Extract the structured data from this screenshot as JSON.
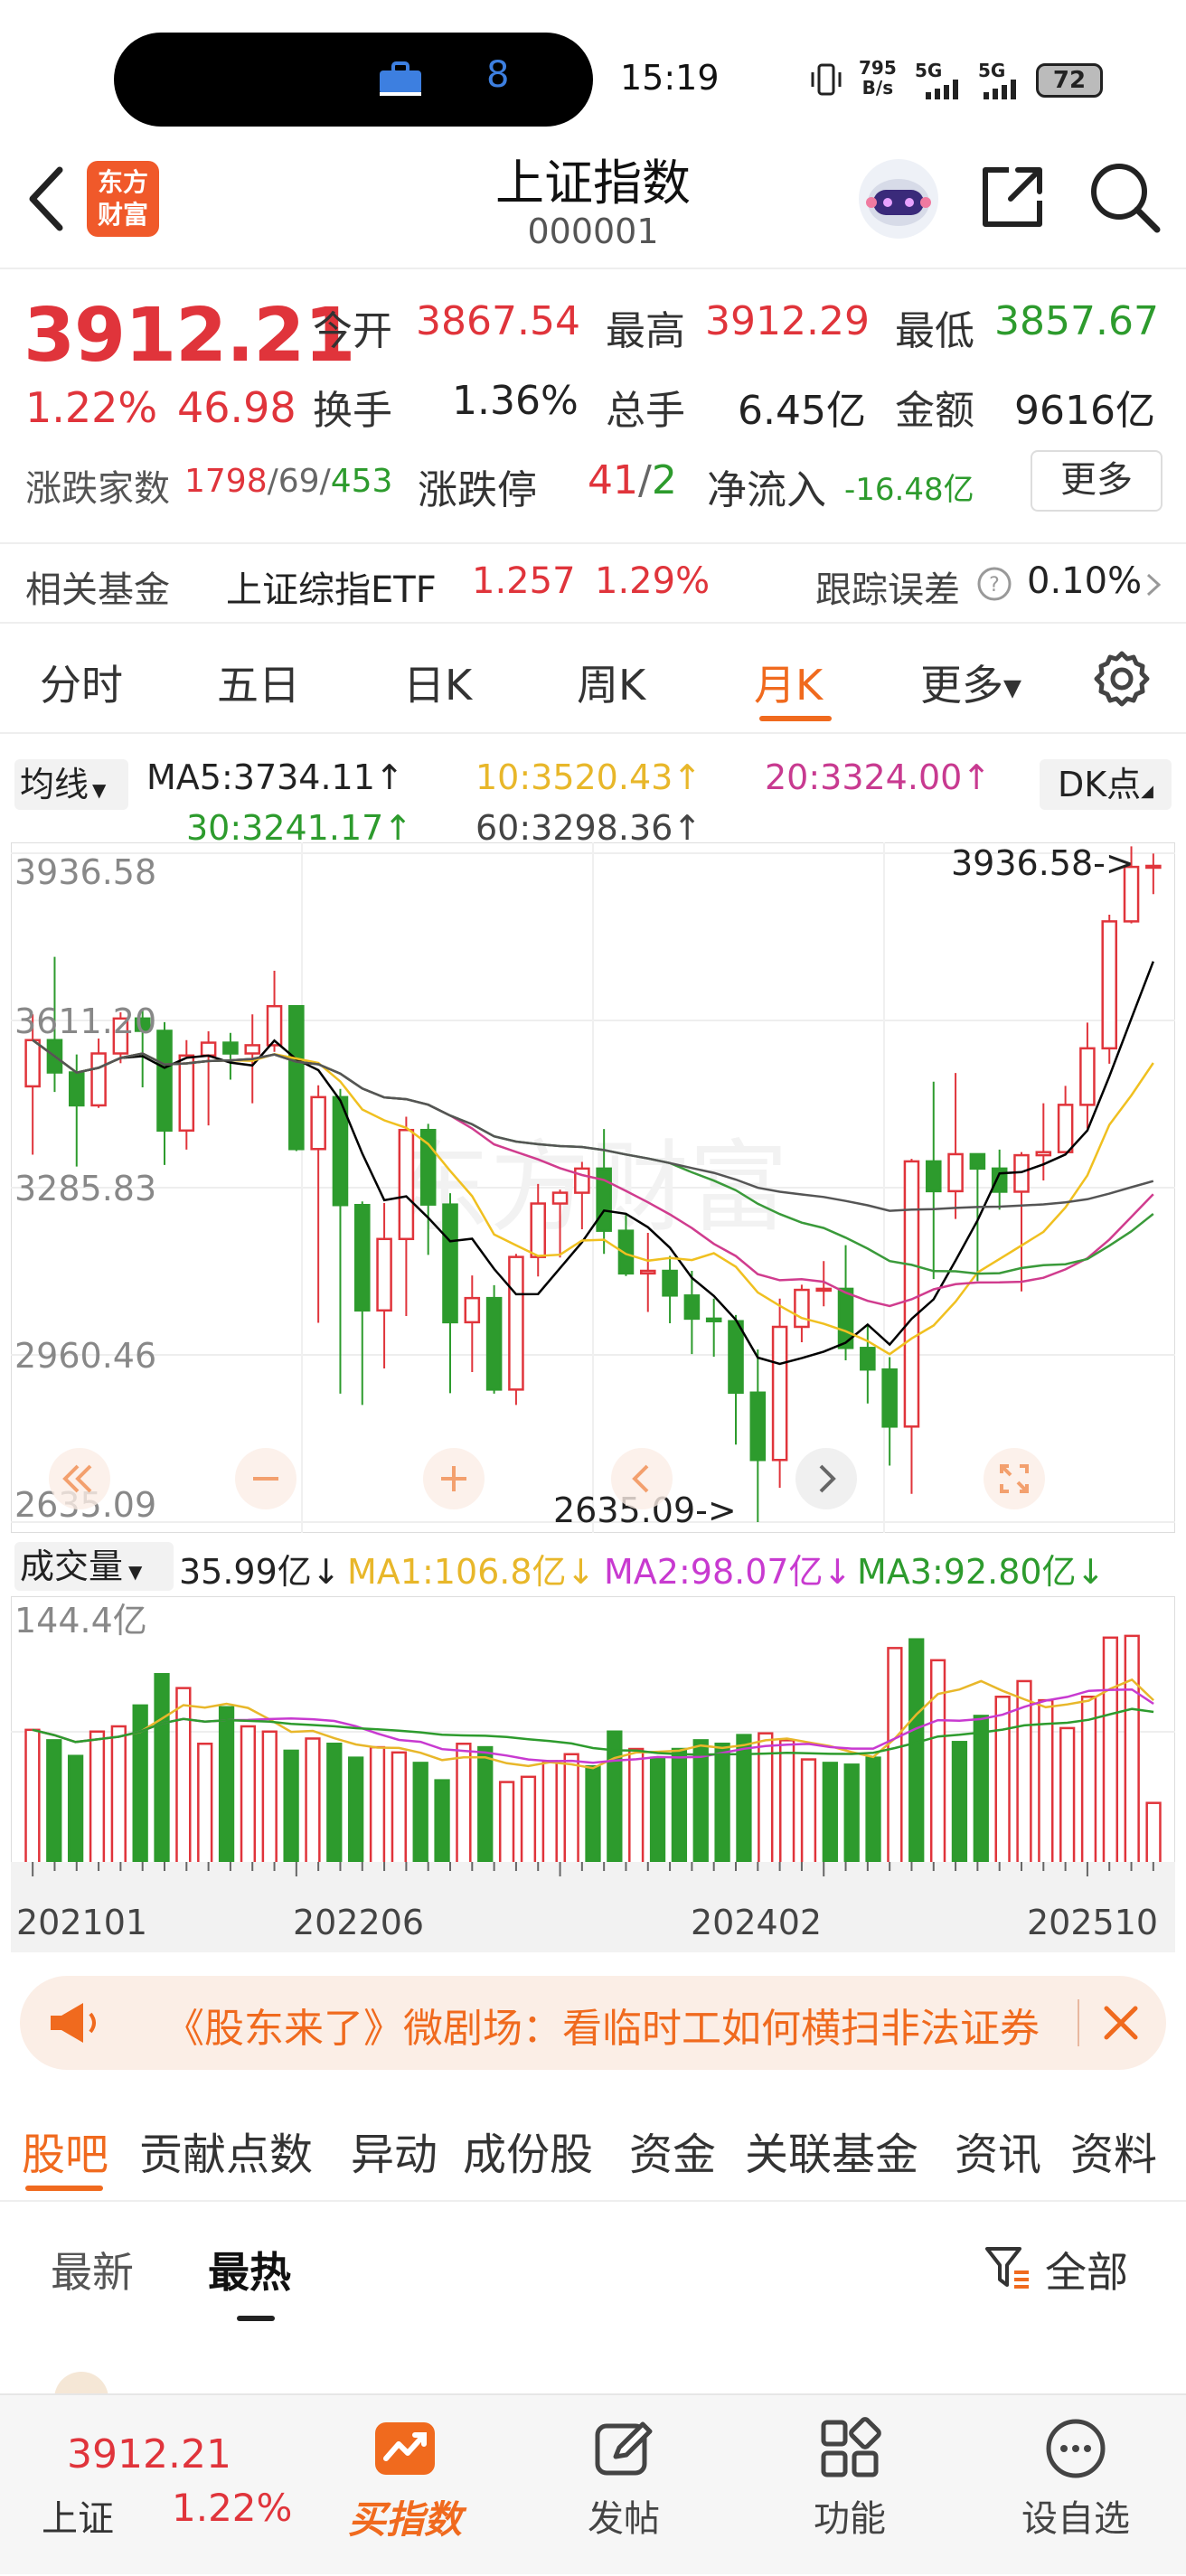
{
  "status": {
    "notif_count": "8",
    "time": "15:19",
    "net_speed_top": "795",
    "net_speed_bottom": "B/s",
    "sig1": "5G",
    "sig2": "5G",
    "battery": "72"
  },
  "header": {
    "logo_top": "东方",
    "logo_bottom": "财富",
    "title": "上证指数",
    "code": "000001"
  },
  "quote": {
    "price": "3912.21",
    "change_pct": "1.22%",
    "change": "46.98",
    "open_label": "今开",
    "open": "3867.54",
    "high_label": "最高",
    "high": "3912.29",
    "low_label": "最低",
    "low": "3857.67",
    "turnover_label": "换手",
    "turnover": "1.36%",
    "volume_label": "总手",
    "volume": "6.45亿",
    "amount_label": "金额",
    "amount": "9616亿",
    "breadth_label": "涨跌家数",
    "up": "1798",
    "flat": "69",
    "down": "453",
    "limit_label": "涨跌停",
    "limit_up": "41",
    "limit_down": "2",
    "inflow_label": "净流入",
    "inflow": "-16.48亿",
    "more": "更多"
  },
  "fund": {
    "label": "相关基金",
    "name": "上证综指ETF",
    "price": "1.257",
    "pct": "1.29%",
    "err_label": "跟踪误差",
    "err": "0.10%"
  },
  "tabs": [
    "分时",
    "五日",
    "日K",
    "周K",
    "月K",
    "更多"
  ],
  "ma": {
    "selector": "均线",
    "ma5": "MA5:3734.11↑",
    "ma10": "10:3520.43↑",
    "ma20": "20:3324.00↑",
    "ma30": "30:3241.17↑",
    "ma60": "60:3298.36↑",
    "dk": "DK点"
  },
  "chart_data": {
    "type": "candlestick",
    "y_ticks": [
      "3936.58",
      "3611.20",
      "3285.83",
      "2960.46",
      "2635.09"
    ],
    "ylim": [
      2635.09,
      3936.58
    ],
    "max_label": "3936.58->",
    "min_label": "2635.09->",
    "x_labels": [
      "202101",
      "202206",
      "202402",
      "202510"
    ],
    "colors": {
      "up": "#e0343b",
      "down": "#2d9b2d",
      "ma5": "#000000",
      "ma10": "#f0c020",
      "ma20": "#d03c8e",
      "ma30": "#3a9a3a",
      "ma60": "#555555"
    },
    "candles": [
      [
        3483,
        3573,
        3350,
        3623
      ],
      [
        3573,
        3510,
        3472,
        3735
      ],
      [
        3510,
        3446,
        3327,
        3545
      ],
      [
        3446,
        3547,
        3441,
        3576
      ],
      [
        3547,
        3615,
        3528,
        3627
      ],
      [
        3615,
        3591,
        3481,
        3631
      ],
      [
        3591,
        3397,
        3330,
        3608
      ],
      [
        3397,
        3543,
        3360,
        3573
      ],
      [
        3543,
        3568,
        3407,
        3590
      ],
      [
        3568,
        3547,
        3496,
        3587
      ],
      [
        3547,
        3563,
        3450,
        3623
      ],
      [
        3563,
        3639,
        3550,
        3708
      ],
      [
        3639,
        3361,
        3357,
        3639
      ],
      [
        3361,
        3462,
        3023,
        3485
      ],
      [
        3462,
        3252,
        2885,
        3478
      ],
      [
        3252,
        3047,
        2863,
        3259
      ],
      [
        3047,
        3186,
        2934,
        3256
      ],
      [
        3186,
        3398,
        3036,
        3424
      ],
      [
        3398,
        3253,
        3155,
        3410
      ],
      [
        3253,
        3024,
        2886,
        3275
      ],
      [
        3024,
        3071,
        2927,
        3115
      ],
      [
        3071,
        2893,
        2885,
        3096
      ],
      [
        2893,
        3151,
        2863,
        3157
      ],
      [
        3151,
        3255,
        3113,
        3293
      ],
      [
        3255,
        3276,
        3150,
        3282
      ],
      [
        3276,
        3323,
        3205,
        3336
      ],
      [
        3323,
        3202,
        3157,
        3400
      ],
      [
        3202,
        3119,
        3114,
        3235
      ],
      [
        3119,
        3124,
        3044,
        3198
      ],
      [
        3124,
        3076,
        3022,
        3153
      ],
      [
        3076,
        3031,
        2962,
        3124
      ],
      [
        3031,
        3026,
        2957,
        3070
      ],
      [
        3026,
        2887,
        2786,
        3038
      ],
      [
        2887,
        2756,
        2635,
        2971
      ],
      [
        2756,
        3015,
        2702,
        3070
      ],
      [
        3015,
        3087,
        2985,
        3097
      ],
      [
        3087,
        3089,
        3055,
        3143
      ],
      [
        3089,
        2974,
        2950,
        3174
      ],
      [
        2974,
        2932,
        2866,
        3020
      ],
      [
        2932,
        2821,
        2745,
        2956
      ],
      [
        2821,
        3337,
        2690,
        3342
      ],
      [
        3337,
        3279,
        3108,
        3492
      ],
      [
        3279,
        3351,
        3225,
        3509
      ],
      [
        3351,
        3323,
        3104,
        3348
      ],
      [
        3323,
        3278,
        3243,
        3360
      ],
      [
        3278,
        3349,
        3084,
        3355
      ],
      [
        3349,
        3355,
        3300,
        3450
      ],
      [
        3355,
        3447,
        3355,
        3484
      ],
      [
        3447,
        3557,
        3401,
        3607
      ],
      [
        3557,
        3804,
        3527,
        3817
      ],
      [
        3804,
        3910,
        3800,
        3950
      ],
      [
        3910,
        3912,
        3857,
        3936
      ]
    ],
    "volume": {
      "label": "成交量",
      "last": "35.99亿↓",
      "ma1": "MA1:106.8亿↓",
      "ma2": "MA2:98.07亿↓",
      "ma3": "MA3:92.80亿↓",
      "max_label": "144.4亿",
      "bars": [
        78,
        72,
        63,
        77,
        80,
        92,
        110,
        102,
        70,
        91,
        80,
        77,
        66,
        73,
        70,
        62,
        68,
        65,
        59,
        49,
        70,
        68,
        48,
        51,
        60,
        64,
        57,
        77,
        67,
        62,
        67,
        72,
        70,
        75,
        76,
        72,
        61,
        59,
        58,
        62,
        125,
        130,
        118,
        71,
        86,
        97,
        106,
        95,
        79,
        97,
        131,
        132,
        36
      ]
    }
  },
  "banner": {
    "text": "《股东来了》微剧场：看临时工如何横扫非法证券"
  },
  "subtabs": [
    "股吧",
    "贡献点数",
    "异动",
    "成份股",
    "资金",
    "关联基金",
    "资讯",
    "资料"
  ],
  "sort": {
    "latest": "最新",
    "hot": "最热",
    "filter": "全部"
  },
  "bottom": {
    "price": "3912.21",
    "name": "上证",
    "pct": "1.22%",
    "buy": "买指数",
    "post": "发帖",
    "func": "功能",
    "watch": "设自选"
  }
}
